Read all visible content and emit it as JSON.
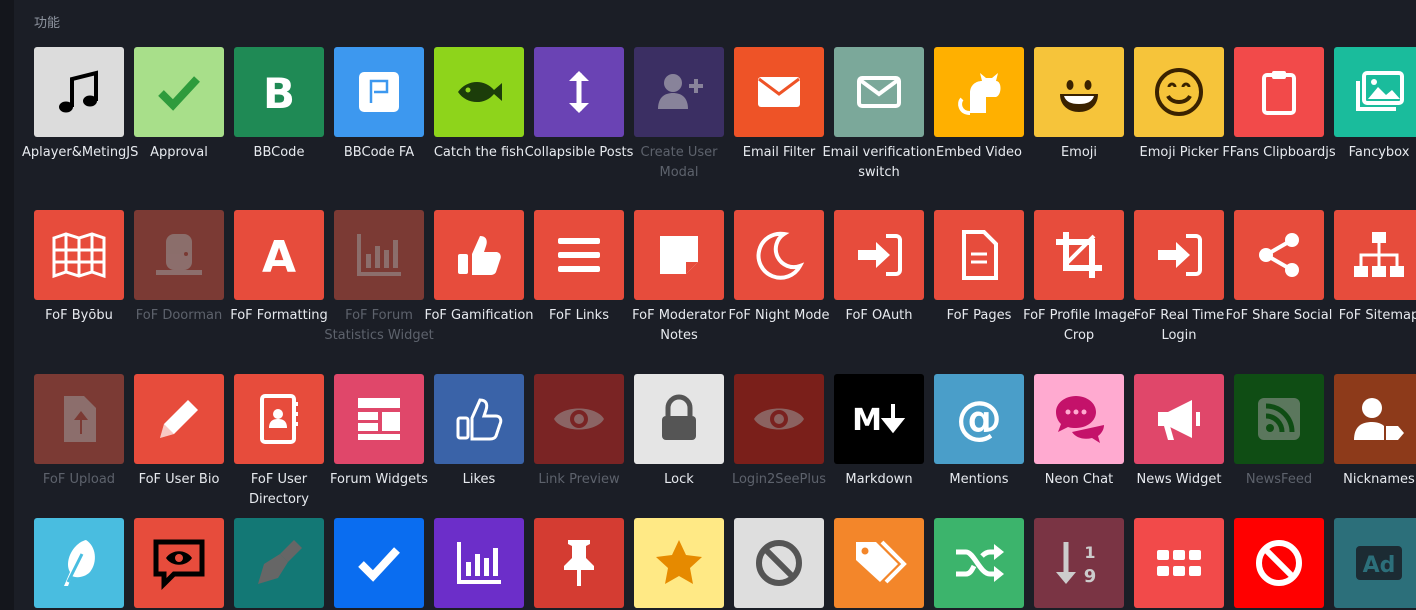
{
  "section": {
    "title": "功能"
  },
  "rows": [
    [
      {
        "label": "Aplayer&MetingJS",
        "bg": "#dcdcdc",
        "fg": "#000000",
        "icon": "music-icon",
        "disabled": false
      },
      {
        "label": "Approval",
        "bg": "#a8df8a",
        "fg": "#2e9b3c",
        "icon": "check-icon",
        "disabled": false
      },
      {
        "label": "BBCode",
        "bg": "#1f8a55",
        "fg": "#ffffff",
        "icon": "letter-b-icon",
        "disabled": false
      },
      {
        "label": "BBCode FA",
        "bg": "#3d98ef",
        "fg": "#ffffff",
        "icon": "flag-icon",
        "disabled": false
      },
      {
        "label": "Catch the fish",
        "bg": "#8ed41b",
        "fg": "#1c3d0a",
        "icon": "fish-icon",
        "disabled": false
      },
      {
        "label": "Collapsible Posts",
        "bg": "#6a43b4",
        "fg": "#ffffff",
        "icon": "arrows-vertical-icon",
        "disabled": false
      },
      {
        "label": "Create User Modal",
        "bg": "#3b2f63",
        "fg": "#c8c8c8",
        "icon": "user-plus-icon",
        "disabled": true
      },
      {
        "label": "Email Filter",
        "bg": "#ee5327",
        "fg": "#ffffff",
        "icon": "envelope-icon",
        "disabled": false
      },
      {
        "label": "Email verification switch",
        "bg": "#7ba89a",
        "fg": "#ffffff",
        "icon": "envelope-outline-icon",
        "disabled": false
      },
      {
        "label": "Embed Video",
        "bg": "#ffb000",
        "fg": "#ffffff",
        "icon": "cat-icon",
        "disabled": false
      },
      {
        "label": "Emoji",
        "bg": "#f6c43a",
        "fg": "#3a2200",
        "icon": "grin-icon",
        "disabled": false
      },
      {
        "label": "Emoji Picker",
        "bg": "#f6c43a",
        "fg": "#3a2200",
        "icon": "smile-icon",
        "disabled": false
      },
      {
        "label": "FFans Clipboardjs",
        "bg": "#f24a4a",
        "fg": "#ffffff",
        "icon": "clipboard-icon",
        "disabled": false
      },
      {
        "label": "Fancybox",
        "bg": "#1abc9c",
        "fg": "#ffffff",
        "icon": "images-icon",
        "disabled": false
      }
    ],
    [
      {
        "label": "FoF Byōbu",
        "bg": "#e74c3c",
        "fg": "#ffffff",
        "icon": "map-icon",
        "disabled": false
      },
      {
        "label": "FoF Doorman",
        "bg": "#7b3a34",
        "fg": "#9a9a9a",
        "icon": "door-icon",
        "disabled": true
      },
      {
        "label": "FoF Formatting",
        "bg": "#e74c3c",
        "fg": "#ffffff",
        "icon": "letter-a-icon",
        "disabled": false
      },
      {
        "label": "FoF Forum Statistics Widget",
        "bg": "#7b3a34",
        "fg": "#9a9a9a",
        "icon": "bar-chart-icon",
        "disabled": true
      },
      {
        "label": "FoF Gamification",
        "bg": "#e74c3c",
        "fg": "#ffffff",
        "icon": "thumbs-up-icon",
        "disabled": false
      },
      {
        "label": "FoF Links",
        "bg": "#e74c3c",
        "fg": "#ffffff",
        "icon": "bars-icon",
        "disabled": false
      },
      {
        "label": "FoF Moderator Notes",
        "bg": "#e74c3c",
        "fg": "#ffffff",
        "icon": "sticky-note-icon",
        "disabled": false
      },
      {
        "label": "FoF Night Mode",
        "bg": "#e74c3c",
        "fg": "#ffffff",
        "icon": "moon-icon",
        "disabled": false
      },
      {
        "label": "FoF OAuth",
        "bg": "#e74c3c",
        "fg": "#ffffff",
        "icon": "sign-in-icon",
        "disabled": false
      },
      {
        "label": "FoF Pages",
        "bg": "#e74c3c",
        "fg": "#ffffff",
        "icon": "file-icon",
        "disabled": false
      },
      {
        "label": "FoF Profile Image Crop",
        "bg": "#e74c3c",
        "fg": "#ffffff",
        "icon": "crop-icon",
        "disabled": false
      },
      {
        "label": "FoF Real Time Login",
        "bg": "#e74c3c",
        "fg": "#ffffff",
        "icon": "sign-in-icon",
        "disabled": false
      },
      {
        "label": "FoF Share Social",
        "bg": "#e74c3c",
        "fg": "#ffffff",
        "icon": "share-icon",
        "disabled": false
      },
      {
        "label": "FoF Sitemap",
        "bg": "#e74c3c",
        "fg": "#ffffff",
        "icon": "sitemap-icon",
        "disabled": false
      }
    ],
    [
      {
        "label": "FoF Upload",
        "bg": "#7b3a34",
        "fg": "#9a9a9a",
        "icon": "file-upload-icon",
        "disabled": true
      },
      {
        "label": "FoF User Bio",
        "bg": "#e74c3c",
        "fg": "#ffffff",
        "icon": "pencil-icon",
        "disabled": false
      },
      {
        "label": "FoF User Directory",
        "bg": "#e74c3c",
        "fg": "#ffffff",
        "icon": "address-book-icon",
        "disabled": false
      },
      {
        "label": "Forum Widgets",
        "bg": "#e0476a",
        "fg": "#ffffff",
        "icon": "layout-icon",
        "disabled": false
      },
      {
        "label": "Likes",
        "bg": "#3a63a8",
        "fg": "#ffffff",
        "icon": "thumbs-up-outline-icon",
        "disabled": false
      },
      {
        "label": "Link Preview",
        "bg": "#7a2424",
        "fg": "#9a9a9a",
        "icon": "eye-icon",
        "disabled": true
      },
      {
        "label": "Lock",
        "bg": "#e5e5e5",
        "fg": "#555555",
        "icon": "lock-icon",
        "disabled": false
      },
      {
        "label": "Login2SeePlus",
        "bg": "#7a1f1a",
        "fg": "#9a9a9a",
        "icon": "eye-icon",
        "disabled": true
      },
      {
        "label": "Markdown",
        "bg": "#000000",
        "fg": "#ffffff",
        "icon": "markdown-icon",
        "disabled": false
      },
      {
        "label": "Mentions",
        "bg": "#4a9ec9",
        "fg": "#ffffff",
        "icon": "at-icon",
        "disabled": false
      },
      {
        "label": "Neon Chat",
        "bg": "#ffaad0",
        "fg": "#c4126a",
        "icon": "comments-icon",
        "disabled": false
      },
      {
        "label": "News Widget",
        "bg": "#e0476a",
        "fg": "#ffffff",
        "icon": "megaphone-icon",
        "disabled": false
      },
      {
        "label": "NewsFeed",
        "bg": "#0f4d14",
        "fg": "#9a9a9a",
        "icon": "rss-icon",
        "disabled": true
      },
      {
        "label": "Nicknames",
        "bg": "#8d3a1a",
        "fg": "#ffffff",
        "icon": "user-tag-icon",
        "disabled": false
      }
    ],
    [
      {
        "label": "",
        "bg": "#49bde0",
        "fg": "#ffffff",
        "icon": "feather-icon",
        "disabled": false
      },
      {
        "label": "",
        "bg": "#e74c3c",
        "fg": "#000000",
        "icon": "eye-comment-icon",
        "disabled": false
      },
      {
        "label": "",
        "bg": "#137875",
        "fg": "#666666",
        "icon": "pen-nib-icon",
        "disabled": false
      },
      {
        "label": "",
        "bg": "#0a6df0",
        "fg": "#ffffff",
        "icon": "check-icon",
        "disabled": false
      },
      {
        "label": "",
        "bg": "#6c2ec9",
        "fg": "#ffffff",
        "icon": "bar-chart-icon",
        "disabled": false
      },
      {
        "label": "",
        "bg": "#d43c32",
        "fg": "#ffffff",
        "icon": "thumbtack-icon",
        "disabled": false
      },
      {
        "label": "",
        "bg": "#ffe985",
        "fg": "#e68a00",
        "icon": "star-icon",
        "disabled": false
      },
      {
        "label": "",
        "bg": "#dedede",
        "fg": "#555555",
        "icon": "ban-icon",
        "disabled": false
      },
      {
        "label": "",
        "bg": "#f3862a",
        "fg": "#ffffff",
        "icon": "tags-icon",
        "disabled": false
      },
      {
        "label": "",
        "bg": "#3cb46c",
        "fg": "#ffffff",
        "icon": "random-icon",
        "disabled": false
      },
      {
        "label": "",
        "bg": "#7a3444",
        "fg": "#cccccc",
        "icon": "sort-numeric-icon",
        "disabled": false
      },
      {
        "label": "",
        "bg": "#f24a4a",
        "fg": "#ffffff",
        "icon": "grid-icon",
        "disabled": false
      },
      {
        "label": "",
        "bg": "#ff0000",
        "fg": "#ffffff",
        "icon": "ban-icon",
        "disabled": false
      },
      {
        "label": "",
        "bg": "#2c6f7a",
        "fg": "#1c2b33",
        "icon": "ad-icon",
        "disabled": false
      }
    ]
  ]
}
